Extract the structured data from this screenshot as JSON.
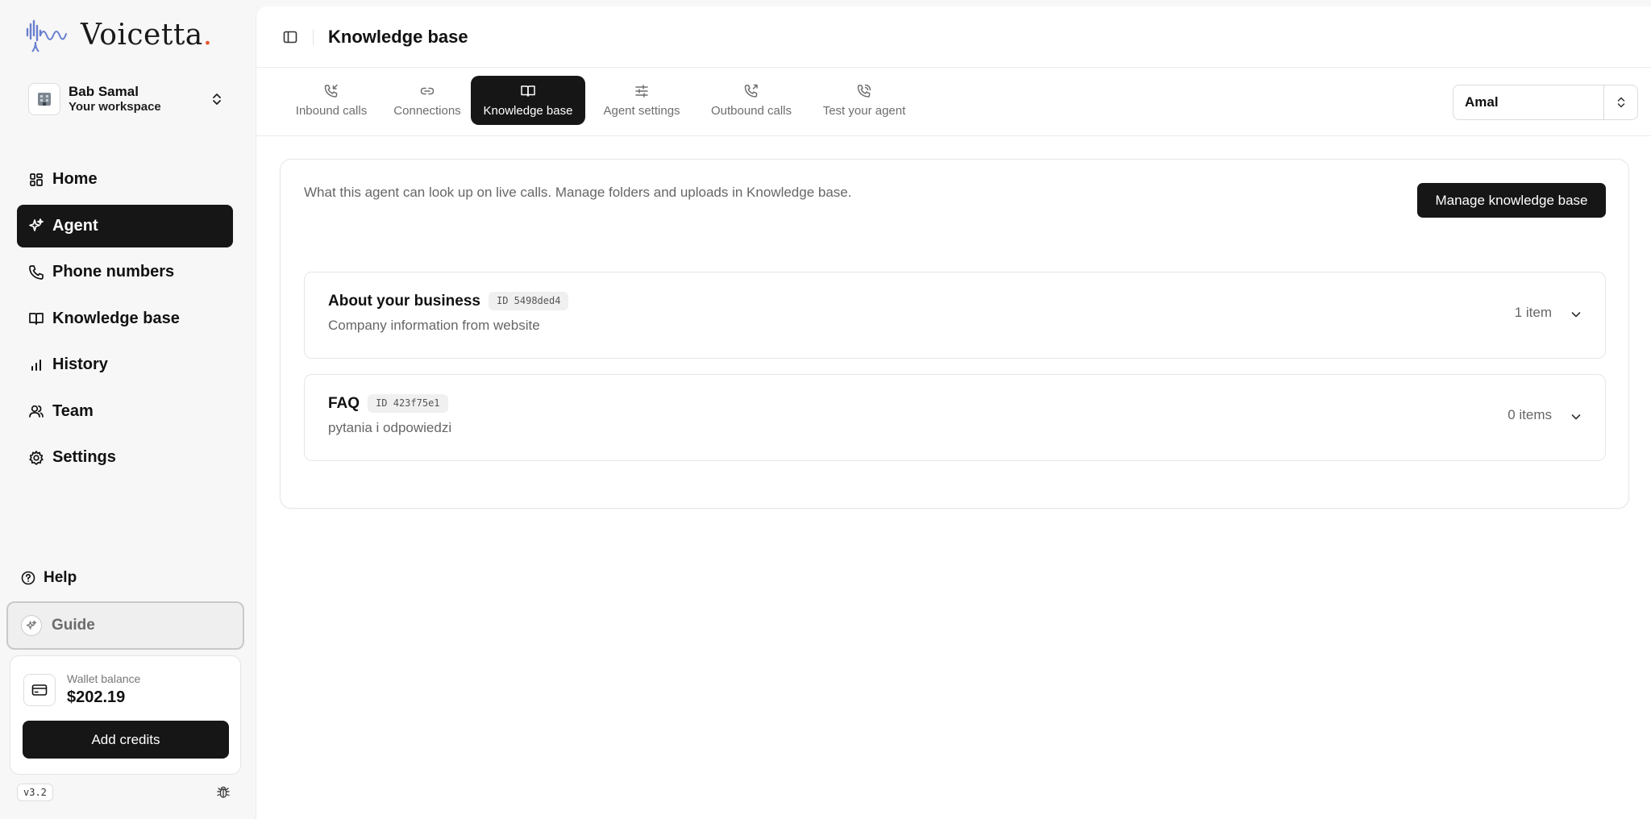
{
  "brand": {
    "name": "Voicetta",
    "dot": ".",
    "accent_color": "#e4572e"
  },
  "workspace": {
    "name": "Bab Samal",
    "subtitle": "Your workspace"
  },
  "nav": {
    "items": [
      {
        "label": "Home",
        "icon": "grid-icon"
      },
      {
        "label": "Agent",
        "icon": "sparkle-icon",
        "active": true
      },
      {
        "label": "Phone numbers",
        "icon": "phone-icon"
      },
      {
        "label": "Knowledge base",
        "icon": "book-icon"
      },
      {
        "label": "History",
        "icon": "bar-chart-icon"
      },
      {
        "label": "Team",
        "icon": "users-icon"
      },
      {
        "label": "Settings",
        "icon": "gear-icon"
      }
    ]
  },
  "help": {
    "label": "Help"
  },
  "guide": {
    "label": "Guide"
  },
  "wallet": {
    "label": "Wallet balance",
    "amount": "$202.19",
    "button": "Add credits"
  },
  "version": "v3.2",
  "header": {
    "title": "Knowledge base"
  },
  "tabs": [
    {
      "label": "Inbound calls",
      "icon": "phone-incoming-icon"
    },
    {
      "label": "Connections",
      "icon": "link-icon"
    },
    {
      "label": "Knowledge base",
      "icon": "book-open-icon",
      "active": true
    },
    {
      "label": "Agent settings",
      "icon": "sliders-icon"
    },
    {
      "label": "Outbound calls",
      "icon": "phone-outgoing-icon"
    },
    {
      "label": "Test your agent",
      "icon": "phone-call-icon"
    }
  ],
  "agent_select": {
    "value": "Amal"
  },
  "panel": {
    "description": "What this agent can look up on live calls. Manage folders and uploads in Knowledge base.",
    "manage_button": "Manage knowledge base",
    "folders": [
      {
        "title": "About your business",
        "id": "ID 5498ded4",
        "description": "Company information from website",
        "count": "1 item"
      },
      {
        "title": "FAQ",
        "id": "ID 423f75e1",
        "description": "pytania i odpowiedzi",
        "count": "0 items"
      }
    ]
  }
}
